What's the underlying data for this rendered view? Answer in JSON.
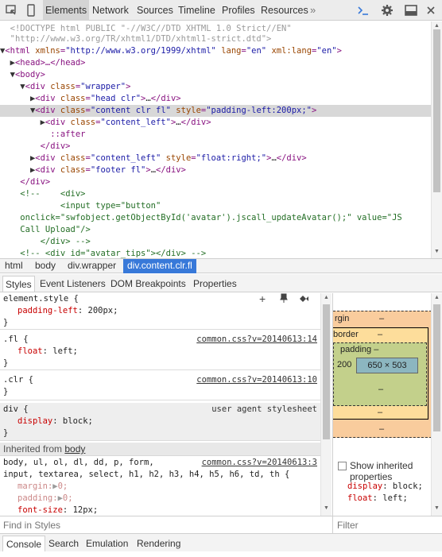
{
  "toolbar": {
    "tabs": [
      "Elements",
      "Network",
      "Sources",
      "Timeline",
      "Profiles",
      "Resources"
    ],
    "active_tab": "Elements",
    "more": "»"
  },
  "dom_tree": {
    "l0": "<!DOCTYPE html PUBLIC \"-//W3C//DTD XHTML 1.0 Strict//EN\"",
    "l1": "\"http://www.w3.org/TR/xhtml1/DTD/xhtml1-strict.dtd\">",
    "l2_tag": "<html ",
    "l2_a1": "xmlns",
    "l2_v1": "\"http://www.w3.org/1999/xhtml\"",
    "l2_a2": "lang",
    "l2_v2": "\"en\"",
    "l2_a3": "xml:lang",
    "l2_v3": "\"en\"",
    "l3": "<head>…</head>",
    "l4": "<body>",
    "l5_tag": "<div ",
    "l5_a": "class",
    "l5_v": "\"wrapper\"",
    "l6_a": "class",
    "l6_v": "\"head clr\"",
    "l7_a1": "class",
    "l7_v1": "\"content clr fl\"",
    "l7_a2": "style",
    "l7_v2": "\"padding-left:200px;\"",
    "l8_a": "class",
    "l8_v": "\"content_left\"",
    "l9": "::after",
    "l10": "</div>",
    "l11_a1": "class",
    "l11_v1": "\"content_left\"",
    "l11_a2": "style",
    "l11_v2": "\"float:right;\"",
    "l12_a": "class",
    "l12_v": "\"footer fl\"",
    "l13": "</div>",
    "l14": "<!--    <div>",
    "l15": "        <input type=\"button\"",
    "l16": "onclick=\"swfobject.getObjectById('avatar').jscall_updateAvatar();\" value=\"JS",
    "l17": "Call Upload\"/>",
    "l18": "    </div> -->",
    "l19": "<!-- <div id=\"avatar_tips\"></div> -->"
  },
  "breadcrumbs": [
    "html",
    "body",
    "div.wrapper",
    "div.content.clr.fl"
  ],
  "sidebar_tabs": [
    "Styles",
    "Event Listeners",
    "DOM Breakpoints",
    "Properties"
  ],
  "styles": {
    "element_selector": "element.style {",
    "element_prop": "padding-left",
    "element_val": "200px;",
    "close": "}",
    "fl_selector": ".fl {",
    "fl_src": "common.css?v=20140613:14",
    "fl_prop": "float",
    "fl_val": "left;",
    "clr_selector": ".clr {",
    "clr_src": "common.css?v=20140613:10",
    "div_selector": "div {",
    "div_src": "user agent stylesheet",
    "div_prop": "display",
    "div_val": "block;",
    "inherited_label": "Inherited from ",
    "inherited_link": "body",
    "body_sel1": "body, ul, ol, dl, dd, p, form,",
    "body_src": "common.css?v=20140613:3",
    "body_sel2": "input, textarea, select, h1, h2, h3, h4, h5, h6, td, th {",
    "p1": "margin",
    "v1": "0;",
    "p2": "padding",
    "v2": "0;",
    "p3": "font-size",
    "v3": "12px;"
  },
  "filters": {
    "styles": "Find in Styles",
    "metrics": "Filter"
  },
  "metrics": {
    "margin": "rgin",
    "dash": "–",
    "border": "border",
    "padding": "padding –",
    "padding_left": "200",
    "content": "650 × 503",
    "show_inherited": "Show inherited\nproperties",
    "cp1": "display",
    "cv1": "block;",
    "cp2": "float",
    "cv2": "left;"
  },
  "drawer_tabs": [
    "Console",
    "Search",
    "Emulation",
    "Rendering"
  ],
  "colors": {
    "selection": "#3879d9",
    "tag": "#881280",
    "attr_name": "#994500",
    "attr_value": "#1a1aa6"
  }
}
